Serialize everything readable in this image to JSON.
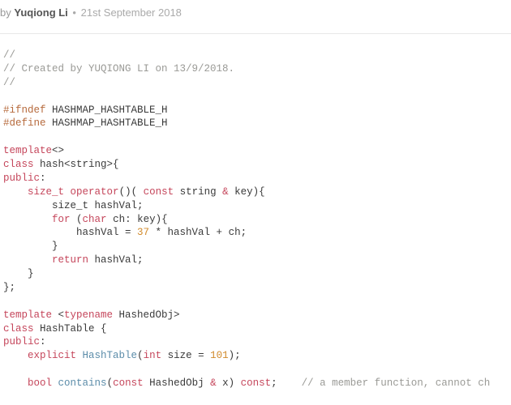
{
  "byline": {
    "by": "by",
    "author": "Yuqiong Li",
    "date": "21st September 2018"
  },
  "code": {
    "l01": "//",
    "l02": "// Created by YUQIONG LI on 13/9/2018.",
    "l03": "//",
    "l04_a": "#ifndef",
    "l04_b": " HASHMAP_HASHTABLE_H",
    "l05_a": "#define",
    "l05_b": " HASHMAP_HASHTABLE_H",
    "l06_kw": "template",
    "l06_b": "<>",
    "l07_a": "class",
    "l07_b": " hash<string>{",
    "l08_a": "public",
    "l08_b": ":",
    "l09_i": "    ",
    "l09_a": "size_t",
    "l09_b": " ",
    "l09_op": "operator",
    "l09_c": "()( ",
    "l09_const": "const",
    "l09_d": " string ",
    "l09_amp": "&",
    "l09_e": " key){",
    "l10": "        size_t hashVal;",
    "l11_i": "        ",
    "l11_for": "for",
    "l11_a": " (",
    "l11_char": "char",
    "l11_b": " ch: key){",
    "l12_a": "            hashVal = ",
    "l12_num": "37",
    "l12_b": " * hashVal + ch;",
    "l13": "        }",
    "l14_i": "        ",
    "l14_ret": "return",
    "l14_b": " hashVal;",
    "l15": "    }",
    "l16": "};",
    "l17_kw": "template",
    "l17_a": " <",
    "l17_tn": "typename",
    "l17_b": " HashedObj>",
    "l18_a": "class",
    "l18_b": " HashTable {",
    "l19_a": "public",
    "l19_b": ":",
    "l20_i": "    ",
    "l20_ex": "explicit",
    "l20_a": " ",
    "l20_fn": "HashTable",
    "l20_b": "(",
    "l20_int": "int",
    "l20_c": " size = ",
    "l20_num": "101",
    "l20_d": ");",
    "l21_i": "    ",
    "l21_bool": "bool",
    "l21_a": " ",
    "l21_fn": "contains",
    "l21_b": "(",
    "l21_const1": "const",
    "l21_c": " HashedObj ",
    "l21_amp": "&",
    "l21_d": " x) ",
    "l21_const2": "const",
    "l21_e": ";    ",
    "l21_cmt": "// a member function, cannot ch"
  }
}
